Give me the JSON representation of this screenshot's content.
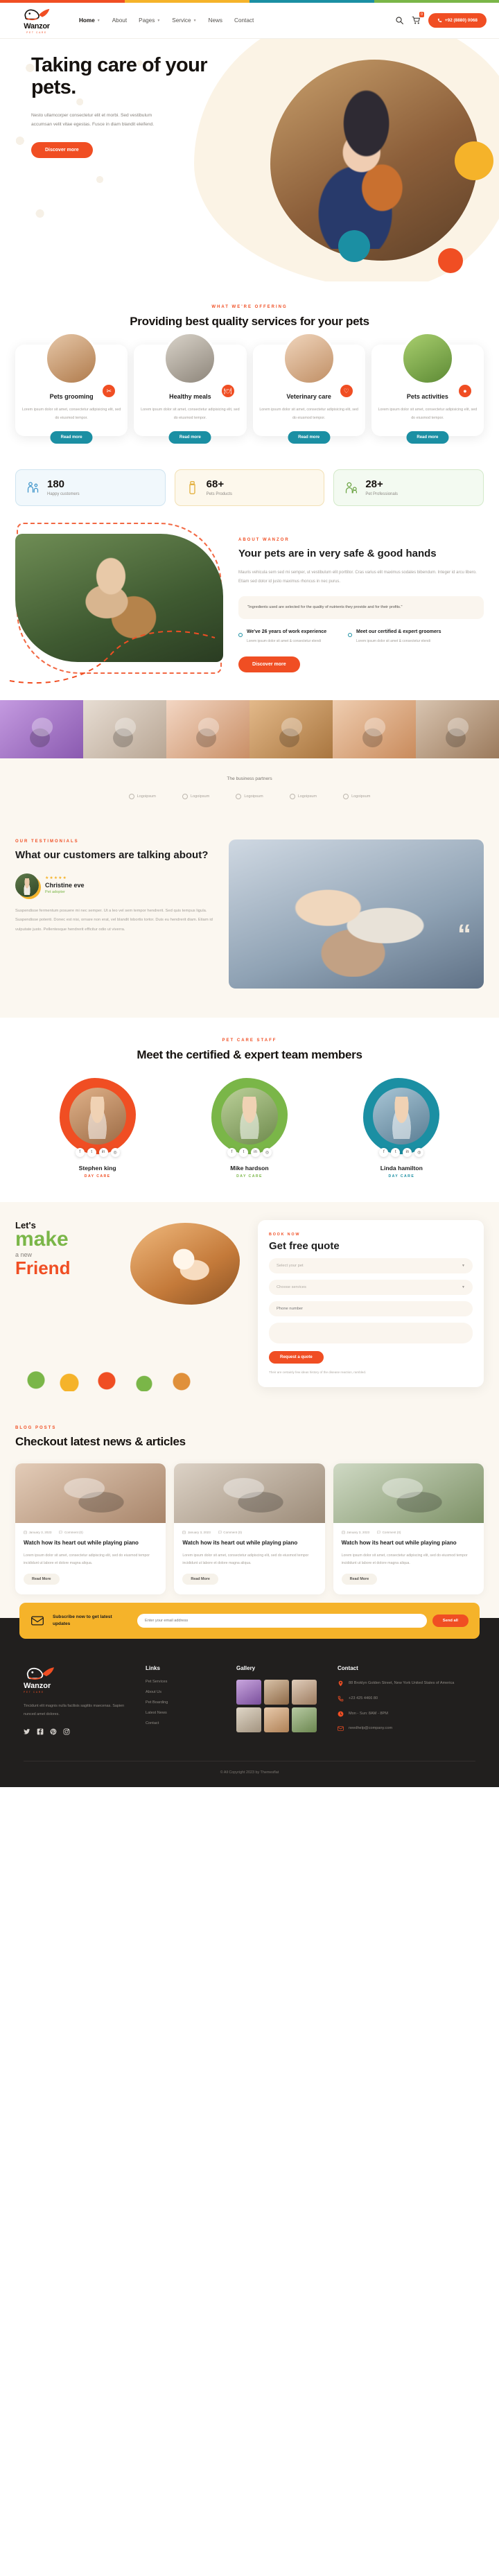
{
  "brand": {
    "name": "Wanzor",
    "tagline": "PET CARE"
  },
  "header": {
    "nav": [
      {
        "label": "Home",
        "has_dropdown": true
      },
      {
        "label": "About",
        "has_dropdown": false
      },
      {
        "label": "Pages",
        "has_dropdown": true
      },
      {
        "label": "Service",
        "has_dropdown": true
      },
      {
        "label": "News",
        "has_dropdown": false
      },
      {
        "label": "Contact",
        "has_dropdown": false
      }
    ],
    "search_icon": "search-icon",
    "cart_icon": "cart-icon",
    "cart_count": "0",
    "phone_button": "+92 (8880) 0068"
  },
  "hero": {
    "title": "Taking care of your pets.",
    "paragraph": "Nesto ullamcorper consectetur elit et morbi. Sed vestibulum accumsan velit vitae egestas. Fusce in diam blandit eleifend.",
    "cta": "Discover more"
  },
  "services": {
    "eyebrow": "WHAT WE'RE OFFERING",
    "title": "Providing best quality services for your pets",
    "cards": [
      {
        "name": "Pets grooming",
        "desc": "Lorem ipsum dolor sit amet, consectetur adipisicing elit, sed do eiusmod tempor.",
        "cta": "Read more",
        "icon": "scissors-icon"
      },
      {
        "name": "Healthy meals",
        "desc": "Lorem ipsum dolor sit amet, consectetur adipisicing elit, sed do eiusmod tempor.",
        "cta": "Read more",
        "icon": "bowl-icon"
      },
      {
        "name": "Veterinary care",
        "desc": "Lorem ipsum dolor sit amet, consectetur adipisicing elit, sed do eiusmod tempor.",
        "cta": "Read more",
        "icon": "stethoscope-icon"
      },
      {
        "name": "Pets activities",
        "desc": "Lorem ipsum dolor sit amet, consectetur adipisicing elit, sed do eiusmod tempor.",
        "cta": "Read more",
        "icon": "ball-icon"
      }
    ]
  },
  "stats": [
    {
      "number": "180",
      "label": "Happy customers",
      "icon": "people-pets-icon"
    },
    {
      "number": "68+",
      "label": "Pets Products",
      "icon": "bottle-icon"
    },
    {
      "number": "28+",
      "label": "Pet Professionals",
      "icon": "person-dog-icon"
    }
  ],
  "about": {
    "eyebrow": "ABOUT WANZOR",
    "title": "Your pets are in very safe & good hands",
    "paragraph": "Mauris vehicula sem sed mi semper, ut vestibulum elit porttitor. Cras varius elit maximus sodales bibendum. Integer id arcu libero. Etiam sed dolor id justo maximus rhoncus in nec purus.",
    "quote": "\"Ingredients used are selected for the quality of nutrients they provide and for their profits.\"",
    "features": [
      {
        "title": "We've 26 years of work experience",
        "desc": "Lorem ipsum dolor sit amet & consectetur elendi"
      },
      {
        "title": "Meet our certified & expert groomers",
        "desc": "Lorem ipsum dolor sit amet & consectetur elendi"
      }
    ],
    "cta": "Discover more"
  },
  "partners": {
    "title": "The business partners",
    "items": [
      {
        "label": "Logoipsum"
      },
      {
        "label": "Logoipsum"
      },
      {
        "label": "Logoipsum"
      },
      {
        "label": "Logoipsum"
      },
      {
        "label": "Logoipsum"
      }
    ]
  },
  "testimonials": {
    "eyebrow": "OUR TESTIMONIALS",
    "title": "What our customers are talking about?",
    "stars": "★★★★★",
    "name": "Christine eve",
    "role": "Pet adopter",
    "body": "Suspendisse fermentum posuere mi nec semper. Ut a leo vel sem tempor hendrerit. Sed quis tempus ligula. Suspendisse potenti. Donec est nisi, ornare non erat, vel blandit lobortis tortor. Duis eu hendrerit diam. Etiam id vulputate justo. Pellentesque hendrerit efficitur odio ut viverra.",
    "quote_mark": "“"
  },
  "team": {
    "eyebrow": "PET CARE STAFF",
    "title": "Meet the certified & expert team members",
    "members": [
      {
        "name": "Stephen king",
        "role": "DAY CARE",
        "socials": [
          "f",
          "t",
          "in",
          "ig"
        ]
      },
      {
        "name": "Mike hardson",
        "role": "DAY CARE",
        "socials": [
          "f",
          "t",
          "in",
          "ig"
        ]
      },
      {
        "name": "Linda hamilton",
        "role": "DAY CARE",
        "socials": [
          "f",
          "t",
          "in",
          "ig"
        ]
      }
    ]
  },
  "friend": {
    "lets": "Let's",
    "make": "make",
    "a_new": "a new",
    "friend": "Friend"
  },
  "quote_form": {
    "eyebrow": "BOOK NOW",
    "title": "Get free quote",
    "fields": [
      {
        "name": "pet-select",
        "placeholder": "Select your pet",
        "type": "select"
      },
      {
        "name": "service-select",
        "placeholder": "Choose services",
        "type": "select"
      },
      {
        "name": "phone-input",
        "placeholder": "Phone number",
        "type": "text"
      },
      {
        "name": "message-input",
        "placeholder": "Message",
        "type": "textarea"
      }
    ],
    "submit": "Request a quote",
    "note": "Their are certainly few ideas history of the disease reaction, rambled."
  },
  "blog": {
    "eyebrow": "BLOG POSTS",
    "title": "Checkout latest news & articles",
    "posts": [
      {
        "date": "January 3, 2023",
        "comments": "Comment (0)",
        "title": "Watch how its heart out while playing piano",
        "desc": "Lorem ipsum dolor sit amet, consectetur adipiscing elit, sed do eiusmod tempor incididunt ut labore et dolore magna aliqua.",
        "cta": "Read More"
      },
      {
        "date": "January 3, 2023",
        "comments": "Comment (0)",
        "title": "Watch how its heart out while playing piano",
        "desc": "Lorem ipsum dolor sit amet, consectetur adipiscing elit, sed do eiusmod tempor incididunt ut labore et dolore magna aliqua.",
        "cta": "Read More"
      },
      {
        "date": "January 3, 2023",
        "comments": "Comment (0)",
        "title": "Watch how its heart out while playing piano",
        "desc": "Lorem ipsum dolor sit amet, consectetur adipiscing elit, sed do eiusmod tempor incididunt ut labore et dolore magna aliqua.",
        "cta": "Read More"
      }
    ]
  },
  "newsletter": {
    "title": "Subscribe now to get latest updates",
    "placeholder": "Enter your email address",
    "button": "Send all",
    "icon": "envelope-icon"
  },
  "footer": {
    "about": "Tincidunt elit magnis nulla facilisis sagittis maecenas. Sapien nunced amet dolores.",
    "socials": [
      {
        "name": "twitter-icon"
      },
      {
        "name": "facebook-icon"
      },
      {
        "name": "pinterest-icon"
      },
      {
        "name": "instagram-icon"
      }
    ],
    "links_head": "Links",
    "links": [
      "Pet Services",
      "About Us",
      "Pet Boarding",
      "Latest News",
      "Contact"
    ],
    "gallery_head": "Gallery",
    "contact_head": "Contact",
    "contact": [
      {
        "icon": "location-icon",
        "text": "88 Broklyn Golden Street, New York United States of America"
      },
      {
        "icon": "phone-icon",
        "text": "+23 425 4466 80"
      },
      {
        "icon": "clock-icon",
        "text": "Mon - Sun: 8AM - 8PM"
      },
      {
        "icon": "mail-icon",
        "text": "needhelp@company.com"
      }
    ],
    "copyright": "© All Copyright 2023 by Themesflat"
  },
  "colors": {
    "orange": "#f04e23",
    "yellow": "#f5b32a",
    "teal": "#1b8fa3",
    "green": "#7ab648",
    "dark": "#211f1e",
    "cream": "#fbf7f0"
  }
}
